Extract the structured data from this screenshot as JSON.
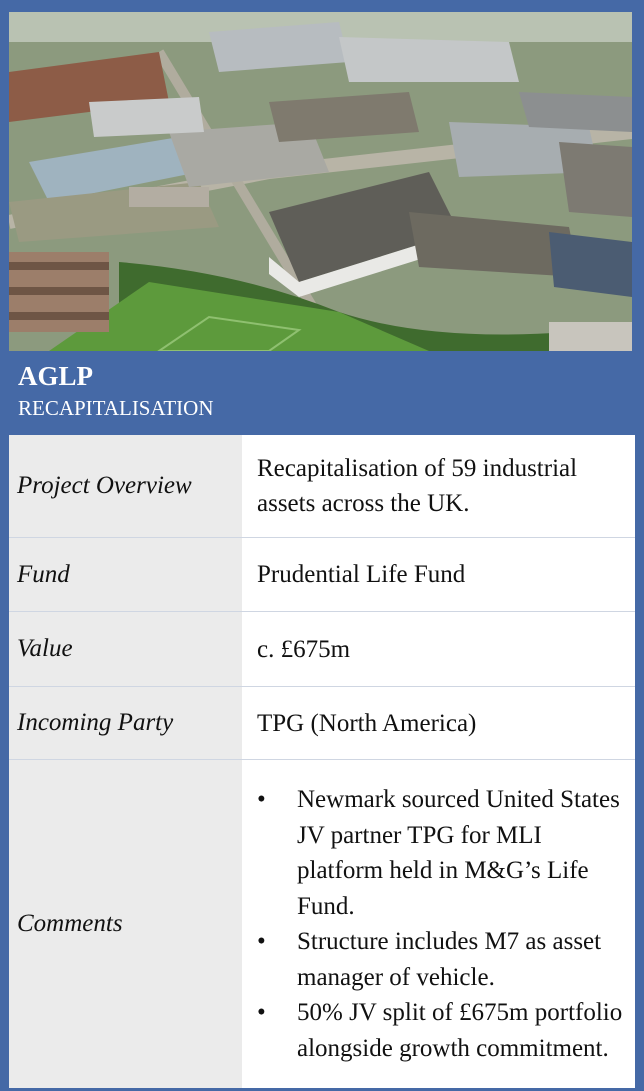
{
  "project": {
    "title": "AGLP",
    "subtitle": "RECAPITALISATION"
  },
  "photo": {
    "description_icon": "aerial-industrial-estate-image"
  },
  "details": [
    {
      "label": "Project Overview",
      "value": "Recapitalisation of 59 industrial assets across the UK."
    },
    {
      "label": "Fund",
      "value": "Prudential Life Fund"
    },
    {
      "label": "Value",
      "value": "c. £675m"
    },
    {
      "label": "Incoming Party",
      "value": "TPG (North America)"
    }
  ],
  "comments": {
    "label": "Comments",
    "items": [
      "Newmark sourced United States JV partner TPG for MLI platform held in M&G’s Life Fund.",
      "Structure includes M7 as asset manager of vehicle.",
      "50% JV split of £675m portfolio alongside growth commitment."
    ]
  },
  "colors": {
    "frame": "#4569a6",
    "label_bg": "#ebebeb",
    "value_bg": "#ffffff"
  }
}
